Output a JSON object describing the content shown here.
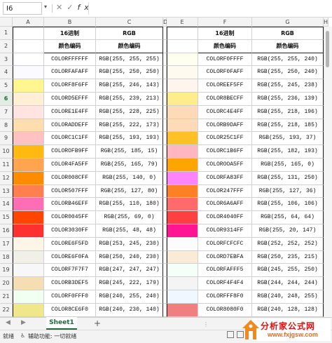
{
  "formula_bar": {
    "name_box": "I6",
    "fx_label": "fx",
    "formula": ""
  },
  "columns": [
    "A",
    "B",
    "C",
    "D",
    "E",
    "F",
    "G",
    "H"
  ],
  "header_row1": {
    "hex": "16进制",
    "rgb": "RGB"
  },
  "header_row2": {
    "hex": "颜色编码",
    "rgb": "颜色编码"
  },
  "row_numbers": [
    "1",
    "2",
    "3",
    "4",
    "5",
    "6",
    "7",
    "8",
    "9",
    "10",
    "11",
    "12",
    "13",
    "14",
    "15",
    "16",
    "17",
    "18",
    "19",
    "20",
    "21",
    "22"
  ],
  "selected_row": "6",
  "left_rows": [
    {
      "swatch": "#FFFFFF",
      "hex": "COLORFFFFFF",
      "rgb": "RGB(255, 255, 255)"
    },
    {
      "swatch": "#FAFAFF",
      "hex": "COLORFAFAFF",
      "rgb": "RGB(255, 250, 250)"
    },
    {
      "swatch": "#FFF68F",
      "hex": "COLORF8F6FF",
      "rgb": "RGB(255, 246, 143)"
    },
    {
      "swatch": "#FFEFD5",
      "hex": "COLORD5EFFF",
      "rgb": "RGB(255, 239, 213)"
    },
    {
      "swatch": "#FFE4E1",
      "hex": "COLORE1E4FF",
      "rgb": "RGB(255, 228, 225)"
    },
    {
      "swatch": "#FFDEAD",
      "hex": "COLORADDEFF",
      "rgb": "RGB(255, 222, 173)"
    },
    {
      "swatch": "#FFC1C1",
      "hex": "COLORC1C1FF",
      "rgb": "RGB(255, 193, 193)"
    },
    {
      "swatch": "#FFB90F",
      "hex": "COLOROFB9FF",
      "rgb": "RGB(255, 185, 15)"
    },
    {
      "swatch": "#FFA54F",
      "hex": "COLOR4FA5FF",
      "rgb": "RGB(255, 165, 79)"
    },
    {
      "swatch": "#FF8C00",
      "hex": "COLOR008CFF",
      "rgb": "RGB(255, 140, 0)"
    },
    {
      "swatch": "#FF7F50",
      "hex": "COLOR507FFF",
      "rgb": "RGB(255, 127, 80)"
    },
    {
      "swatch": "#FF6EB4",
      "hex": "COLORB46EFF",
      "rgb": "RGB(255, 110, 180)"
    },
    {
      "swatch": "#FF4500",
      "hex": "COLOR0045FF",
      "rgb": "RGB(255, 69, 0)"
    },
    {
      "swatch": "#FF3030",
      "hex": "COLOR3030FF",
      "rgb": "RGB(255, 48, 48)"
    },
    {
      "swatch": "#FDF5E6",
      "hex": "COLORE6F5FD",
      "rgb": "RGB(253, 245, 230)"
    },
    {
      "swatch": "#F0F0E6",
      "hex": "COLORE6F0FA",
      "rgb": "RGB(250, 240, 230)"
    },
    {
      "swatch": "#F7F7F7",
      "hex": "COLORF7F7F7",
      "rgb": "RGB(247, 247, 247)"
    },
    {
      "swatch": "#F5DEB3",
      "hex": "COLORB3DEF5",
      "rgb": "RGB(245, 222, 179)"
    },
    {
      "swatch": "#F0FFF0",
      "hex": "COLORF0FFF0",
      "rgb": "RGB(240, 255, 240)"
    },
    {
      "swatch": "#F0E68C",
      "hex": "COLOR8CE6F0",
      "rgb": "RGB(240, 230, 140)"
    }
  ],
  "right_rows": [
    {
      "swatch": "#FFFFF0",
      "hex": "COLORF0FFFF",
      "rgb": "RGB(255, 255, 240)"
    },
    {
      "swatch": "#FFFAF0",
      "hex": "COLORF0FAFF",
      "rgb": "RGB(255, 250, 240)"
    },
    {
      "swatch": "#FFF5EE",
      "hex": "COLOREEF5FF",
      "rgb": "RGB(255, 245, 238)"
    },
    {
      "swatch": "#FFEC8B",
      "hex": "COLOR8BECFF",
      "rgb": "RGB(255, 236, 139)"
    },
    {
      "swatch": "#FFDAB9",
      "hex": "COLORC4E4FF",
      "rgb": "RGB(255, 218, 196)"
    },
    {
      "swatch": "#FFDAB9",
      "hex": "COLORB9DAFF",
      "rgb": "RGB(255, 218, 185)"
    },
    {
      "swatch": "#FFC125",
      "hex": "COLOR25C1FF",
      "rgb": "RGB(255, 193, 37)"
    },
    {
      "swatch": "#FFB6C1",
      "hex": "COLORC1B6FF",
      "rgb": "RGB(255, 182, 193)"
    },
    {
      "swatch": "#FFA500",
      "hex": "COLOROOA5FF",
      "rgb": "RGB(255, 165, 0)"
    },
    {
      "swatch": "#FF83FA",
      "hex": "COLORFA83FF",
      "rgb": "RGB(255, 131, 250)"
    },
    {
      "swatch": "#FF7F24",
      "hex": "COLOR247FFF",
      "rgb": "RGB(255, 127, 36)"
    },
    {
      "swatch": "#FF6A6A",
      "hex": "COLOR6A6AFF",
      "rgb": "RGB(255, 106, 106)"
    },
    {
      "swatch": "#FF4040",
      "hex": "COLOR4040FF",
      "rgb": "RGB(255, 64, 64)"
    },
    {
      "swatch": "#FF1493",
      "hex": "COLOR9314FF",
      "rgb": "RGB(255, 20, 147)"
    },
    {
      "swatch": "#FCFCFC",
      "hex": "COLORFCFCFC",
      "rgb": "RGB(252, 252, 252)"
    },
    {
      "swatch": "#FAEBD7",
      "hex": "COLORD7EBFA",
      "rgb": "RGB(250, 235, 215)"
    },
    {
      "swatch": "#F5FFFA",
      "hex": "COLORFAFFF5",
      "rgb": "RGB(245, 255, 250)"
    },
    {
      "swatch": "#F4F4F4",
      "hex": "COLORF4F4F4",
      "rgb": "RGB(244, 244, 244)"
    },
    {
      "swatch": "#F0F8FF",
      "hex": "COLORFFF8F0",
      "rgb": "RGB(240, 248, 255)"
    },
    {
      "swatch": "#F08080",
      "hex": "COLOR8080F0",
      "rgb": "RGB(240, 128, 128)"
    }
  ],
  "sheet_tabs": [
    "Sheet1"
  ],
  "add_sheet": "+",
  "status": {
    "ready": "就绪",
    "accessibility": "辅助功能: 一切就绪"
  },
  "watermark": {
    "main": "分析家公式网",
    "sub": "www.fxjgsw.com"
  }
}
